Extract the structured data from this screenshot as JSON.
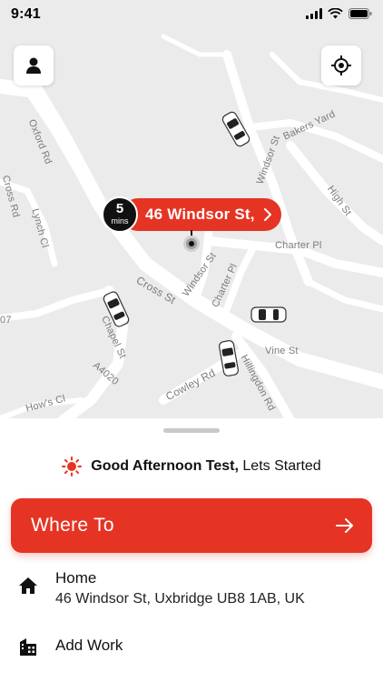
{
  "status_bar": {
    "time": "9:41"
  },
  "map": {
    "road_labels": {
      "oxford_rd": "Oxford Rd",
      "bakers_yard": "Bakers Yard",
      "windsor_st_top": "Windsor St",
      "high_st": "High St",
      "cross_rd": "Cross Rd",
      "lynch_cl": "Lynch Cl",
      "charter_pl": "Charter Pl",
      "charter_pl_2": "Charter Pl",
      "cross_st": "Cross St",
      "windsor_st_mid": "Windsor St",
      "chapel_st": "Chapel St",
      "vine_st": "Vine St",
      "a4020": "A4020",
      "cowley_rd": "Cowley Rd",
      "hillingdon_rd": "Hillingdon Rd",
      "hows_cl": "How's Cl",
      "edge_07": "07"
    },
    "pickup": {
      "eta_value": "5",
      "eta_unit": "mins",
      "address": "46 Windsor St,"
    },
    "buttons": {
      "profile_icon": "person-icon",
      "locate_icon": "crosshair-icon"
    }
  },
  "sheet": {
    "greeting_bold": "Good Afternoon Test,",
    "greeting_rest": "Lets Started",
    "where_to_label": "Where To",
    "places": [
      {
        "title": "Home",
        "subtitle": "46 Windsor St, Uxbridge UB8 1AB, UK",
        "icon": "home-icon"
      },
      {
        "title": "Add Work",
        "subtitle": "",
        "icon": "building-icon"
      }
    ]
  },
  "colors": {
    "accent": "#e53424",
    "map_bg": "#ebebeb",
    "road": "#ffffff"
  }
}
